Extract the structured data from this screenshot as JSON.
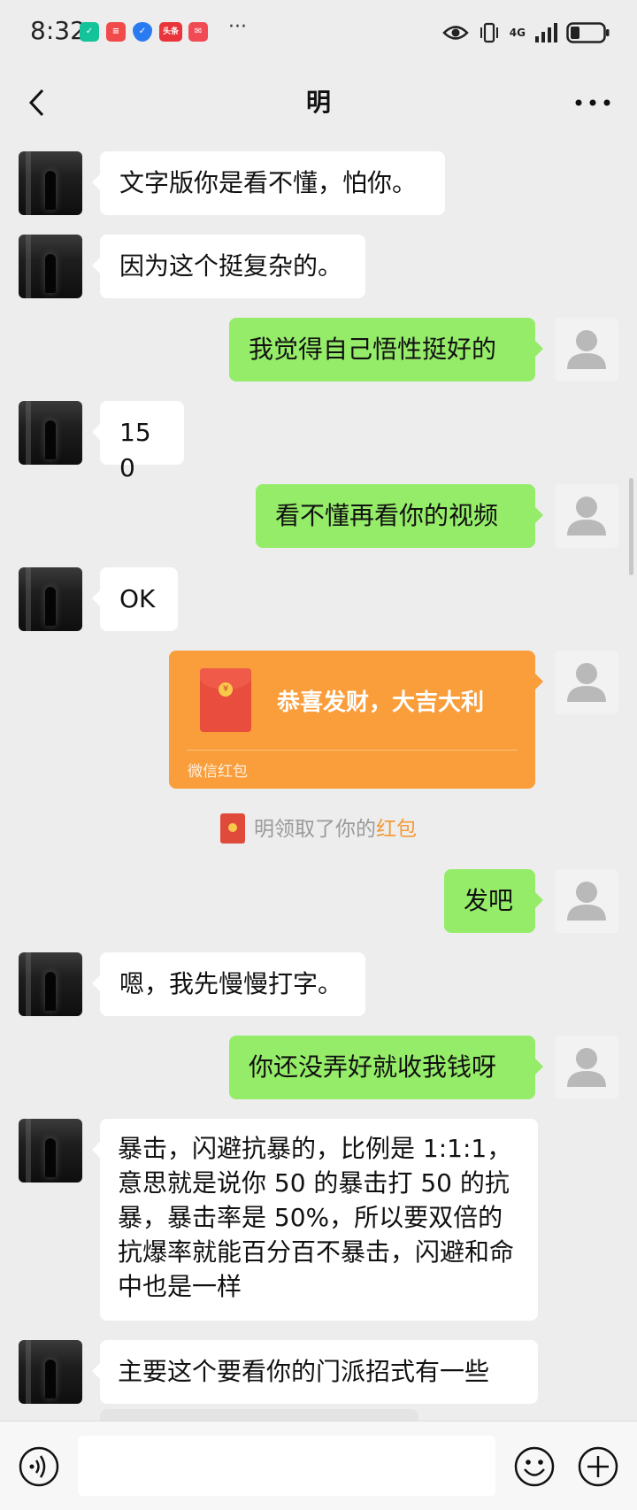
{
  "status_bar": {
    "time": "8:32",
    "more_indicator": "···",
    "network_label": "4G",
    "apps": [
      {
        "name": "shield-app",
        "color": "#14c39a"
      },
      {
        "name": "stack-app",
        "color": "#f04a4a"
      },
      {
        "name": "security-app",
        "color": "#2b7bf0"
      },
      {
        "name": "toutiao-app",
        "color": "#e8343a",
        "label": "头条"
      },
      {
        "name": "mail-app",
        "color": "#f04a54"
      }
    ]
  },
  "header": {
    "title": "明"
  },
  "messages": [
    {
      "side": "left",
      "text": "文字版你是看不懂，怕你。"
    },
    {
      "side": "left",
      "text": "因为这个挺复杂的。"
    },
    {
      "side": "right",
      "text": "我觉得自己悟性挺好的"
    },
    {
      "side": "left",
      "text": "150"
    },
    {
      "side": "right",
      "text": "看不懂再看你的视频"
    },
    {
      "side": "left",
      "text": "OK"
    },
    {
      "side": "right",
      "text": "发吧"
    },
    {
      "side": "left",
      "text": "嗯，我先慢慢打字。"
    },
    {
      "side": "right",
      "text": "你还没弄好就收我钱呀"
    },
    {
      "side": "left",
      "text": "暴击，闪避抗暴的，比例是 1:1:1，意思就是说你 50 的暴击打 50 的抗暴，暴击率是 50%，所以要双倍的抗爆率就能百分百不暴击，闪避和命中也是一样"
    },
    {
      "side": "left",
      "text": "主要这个要看你的门派招式有一些"
    }
  ],
  "red_packet": {
    "title": "恭喜发财，大吉大利",
    "label": "微信红包",
    "coin_symbol": "¥"
  },
  "system_notice": {
    "text_prefix": "明领取了你的",
    "link_text": "红包"
  },
  "input_bar": {
    "value": "",
    "placeholder": ""
  },
  "colors": {
    "background": "#ededed",
    "outgoing_bubble": "#95ec69",
    "incoming_bubble": "#ffffff",
    "red_packet": "#fa9d3b"
  }
}
